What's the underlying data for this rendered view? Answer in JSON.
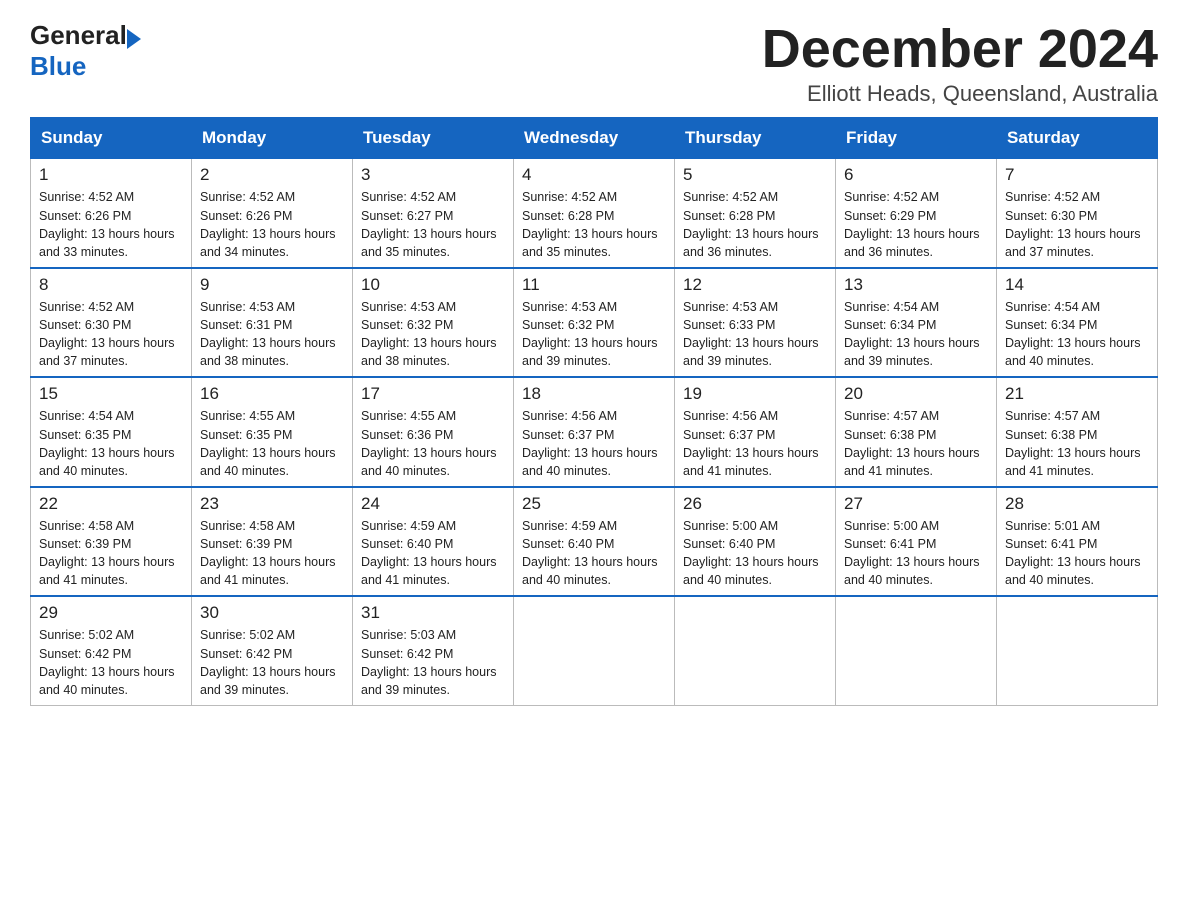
{
  "header": {
    "logo_general": "General",
    "logo_blue": "Blue",
    "month_title": "December 2024",
    "location": "Elliott Heads, Queensland, Australia"
  },
  "weekdays": [
    "Sunday",
    "Monday",
    "Tuesday",
    "Wednesday",
    "Thursday",
    "Friday",
    "Saturday"
  ],
  "weeks": [
    [
      {
        "day": "1",
        "sunrise": "4:52 AM",
        "sunset": "6:26 PM",
        "daylight": "13 hours and 33 minutes."
      },
      {
        "day": "2",
        "sunrise": "4:52 AM",
        "sunset": "6:26 PM",
        "daylight": "13 hours and 34 minutes."
      },
      {
        "day": "3",
        "sunrise": "4:52 AM",
        "sunset": "6:27 PM",
        "daylight": "13 hours and 35 minutes."
      },
      {
        "day": "4",
        "sunrise": "4:52 AM",
        "sunset": "6:28 PM",
        "daylight": "13 hours and 35 minutes."
      },
      {
        "day": "5",
        "sunrise": "4:52 AM",
        "sunset": "6:28 PM",
        "daylight": "13 hours and 36 minutes."
      },
      {
        "day": "6",
        "sunrise": "4:52 AM",
        "sunset": "6:29 PM",
        "daylight": "13 hours and 36 minutes."
      },
      {
        "day": "7",
        "sunrise": "4:52 AM",
        "sunset": "6:30 PM",
        "daylight": "13 hours and 37 minutes."
      }
    ],
    [
      {
        "day": "8",
        "sunrise": "4:52 AM",
        "sunset": "6:30 PM",
        "daylight": "13 hours and 37 minutes."
      },
      {
        "day": "9",
        "sunrise": "4:53 AM",
        "sunset": "6:31 PM",
        "daylight": "13 hours and 38 minutes."
      },
      {
        "day": "10",
        "sunrise": "4:53 AM",
        "sunset": "6:32 PM",
        "daylight": "13 hours and 38 minutes."
      },
      {
        "day": "11",
        "sunrise": "4:53 AM",
        "sunset": "6:32 PM",
        "daylight": "13 hours and 39 minutes."
      },
      {
        "day": "12",
        "sunrise": "4:53 AM",
        "sunset": "6:33 PM",
        "daylight": "13 hours and 39 minutes."
      },
      {
        "day": "13",
        "sunrise": "4:54 AM",
        "sunset": "6:34 PM",
        "daylight": "13 hours and 39 minutes."
      },
      {
        "day": "14",
        "sunrise": "4:54 AM",
        "sunset": "6:34 PM",
        "daylight": "13 hours and 40 minutes."
      }
    ],
    [
      {
        "day": "15",
        "sunrise": "4:54 AM",
        "sunset": "6:35 PM",
        "daylight": "13 hours and 40 minutes."
      },
      {
        "day": "16",
        "sunrise": "4:55 AM",
        "sunset": "6:35 PM",
        "daylight": "13 hours and 40 minutes."
      },
      {
        "day": "17",
        "sunrise": "4:55 AM",
        "sunset": "6:36 PM",
        "daylight": "13 hours and 40 minutes."
      },
      {
        "day": "18",
        "sunrise": "4:56 AM",
        "sunset": "6:37 PM",
        "daylight": "13 hours and 40 minutes."
      },
      {
        "day": "19",
        "sunrise": "4:56 AM",
        "sunset": "6:37 PM",
        "daylight": "13 hours and 41 minutes."
      },
      {
        "day": "20",
        "sunrise": "4:57 AM",
        "sunset": "6:38 PM",
        "daylight": "13 hours and 41 minutes."
      },
      {
        "day": "21",
        "sunrise": "4:57 AM",
        "sunset": "6:38 PM",
        "daylight": "13 hours and 41 minutes."
      }
    ],
    [
      {
        "day": "22",
        "sunrise": "4:58 AM",
        "sunset": "6:39 PM",
        "daylight": "13 hours and 41 minutes."
      },
      {
        "day": "23",
        "sunrise": "4:58 AM",
        "sunset": "6:39 PM",
        "daylight": "13 hours and 41 minutes."
      },
      {
        "day": "24",
        "sunrise": "4:59 AM",
        "sunset": "6:40 PM",
        "daylight": "13 hours and 41 minutes."
      },
      {
        "day": "25",
        "sunrise": "4:59 AM",
        "sunset": "6:40 PM",
        "daylight": "13 hours and 40 minutes."
      },
      {
        "day": "26",
        "sunrise": "5:00 AM",
        "sunset": "6:40 PM",
        "daylight": "13 hours and 40 minutes."
      },
      {
        "day": "27",
        "sunrise": "5:00 AM",
        "sunset": "6:41 PM",
        "daylight": "13 hours and 40 minutes."
      },
      {
        "day": "28",
        "sunrise": "5:01 AM",
        "sunset": "6:41 PM",
        "daylight": "13 hours and 40 minutes."
      }
    ],
    [
      {
        "day": "29",
        "sunrise": "5:02 AM",
        "sunset": "6:42 PM",
        "daylight": "13 hours and 40 minutes."
      },
      {
        "day": "30",
        "sunrise": "5:02 AM",
        "sunset": "6:42 PM",
        "daylight": "13 hours and 39 minutes."
      },
      {
        "day": "31",
        "sunrise": "5:03 AM",
        "sunset": "6:42 PM",
        "daylight": "13 hours and 39 minutes."
      },
      null,
      null,
      null,
      null
    ]
  ],
  "labels": {
    "sunrise": "Sunrise:",
    "sunset": "Sunset:",
    "daylight": "Daylight:"
  }
}
